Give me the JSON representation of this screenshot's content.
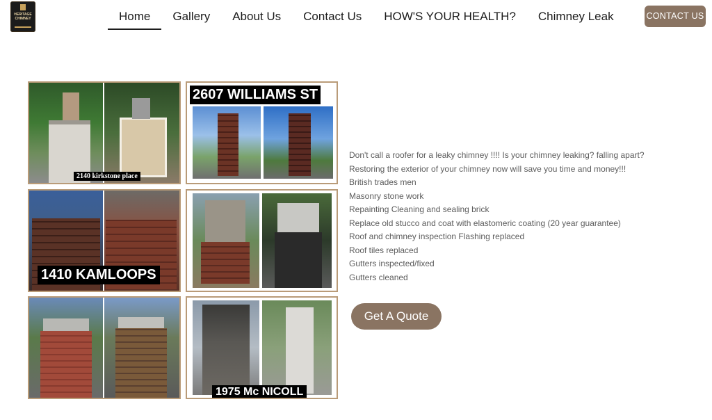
{
  "header": {
    "logo_text": "HERITAGE CHIMNEY",
    "nav": [
      {
        "label": "Home",
        "active": true
      },
      {
        "label": "Gallery",
        "active": false
      },
      {
        "label": "About Us",
        "active": false
      },
      {
        "label": "Contact Us",
        "active": false
      },
      {
        "label": "HOW'S YOUR HEALTH?",
        "active": false
      },
      {
        "label": "Chimney Leak",
        "active": false
      }
    ],
    "cta": "CONTACT US"
  },
  "gallery": [
    {
      "caption": "2140 kirkstone place"
    },
    {
      "caption": "2607 WILLIAMS ST"
    },
    {
      "caption": "1410 KAMLOOPS"
    },
    {
      "caption": ""
    },
    {
      "caption": ""
    },
    {
      "caption": "1975 Mc NICOLL"
    }
  ],
  "features": [
    "Don't call a roofer for a leaky chimney !!!! Is your chimney leaking? falling apart?",
    "Restoring the exterior of your chimney now will save you time and money!!!",
    "British trades men",
    "Masonry stone work",
    "Repainting Cleaning and sealing brick",
    "Replace old stucco and coat with elastomeric coating (20 year guarantee)",
    "Roof and chimney inspection Flashing replaced",
    "Roof tiles replaced",
    "Gutters inspected/fixed",
    "Gutters cleaned"
  ],
  "quote_button": "Get A Quote",
  "colors": {
    "accent": "#8a7462",
    "frame": "#b99b78"
  }
}
